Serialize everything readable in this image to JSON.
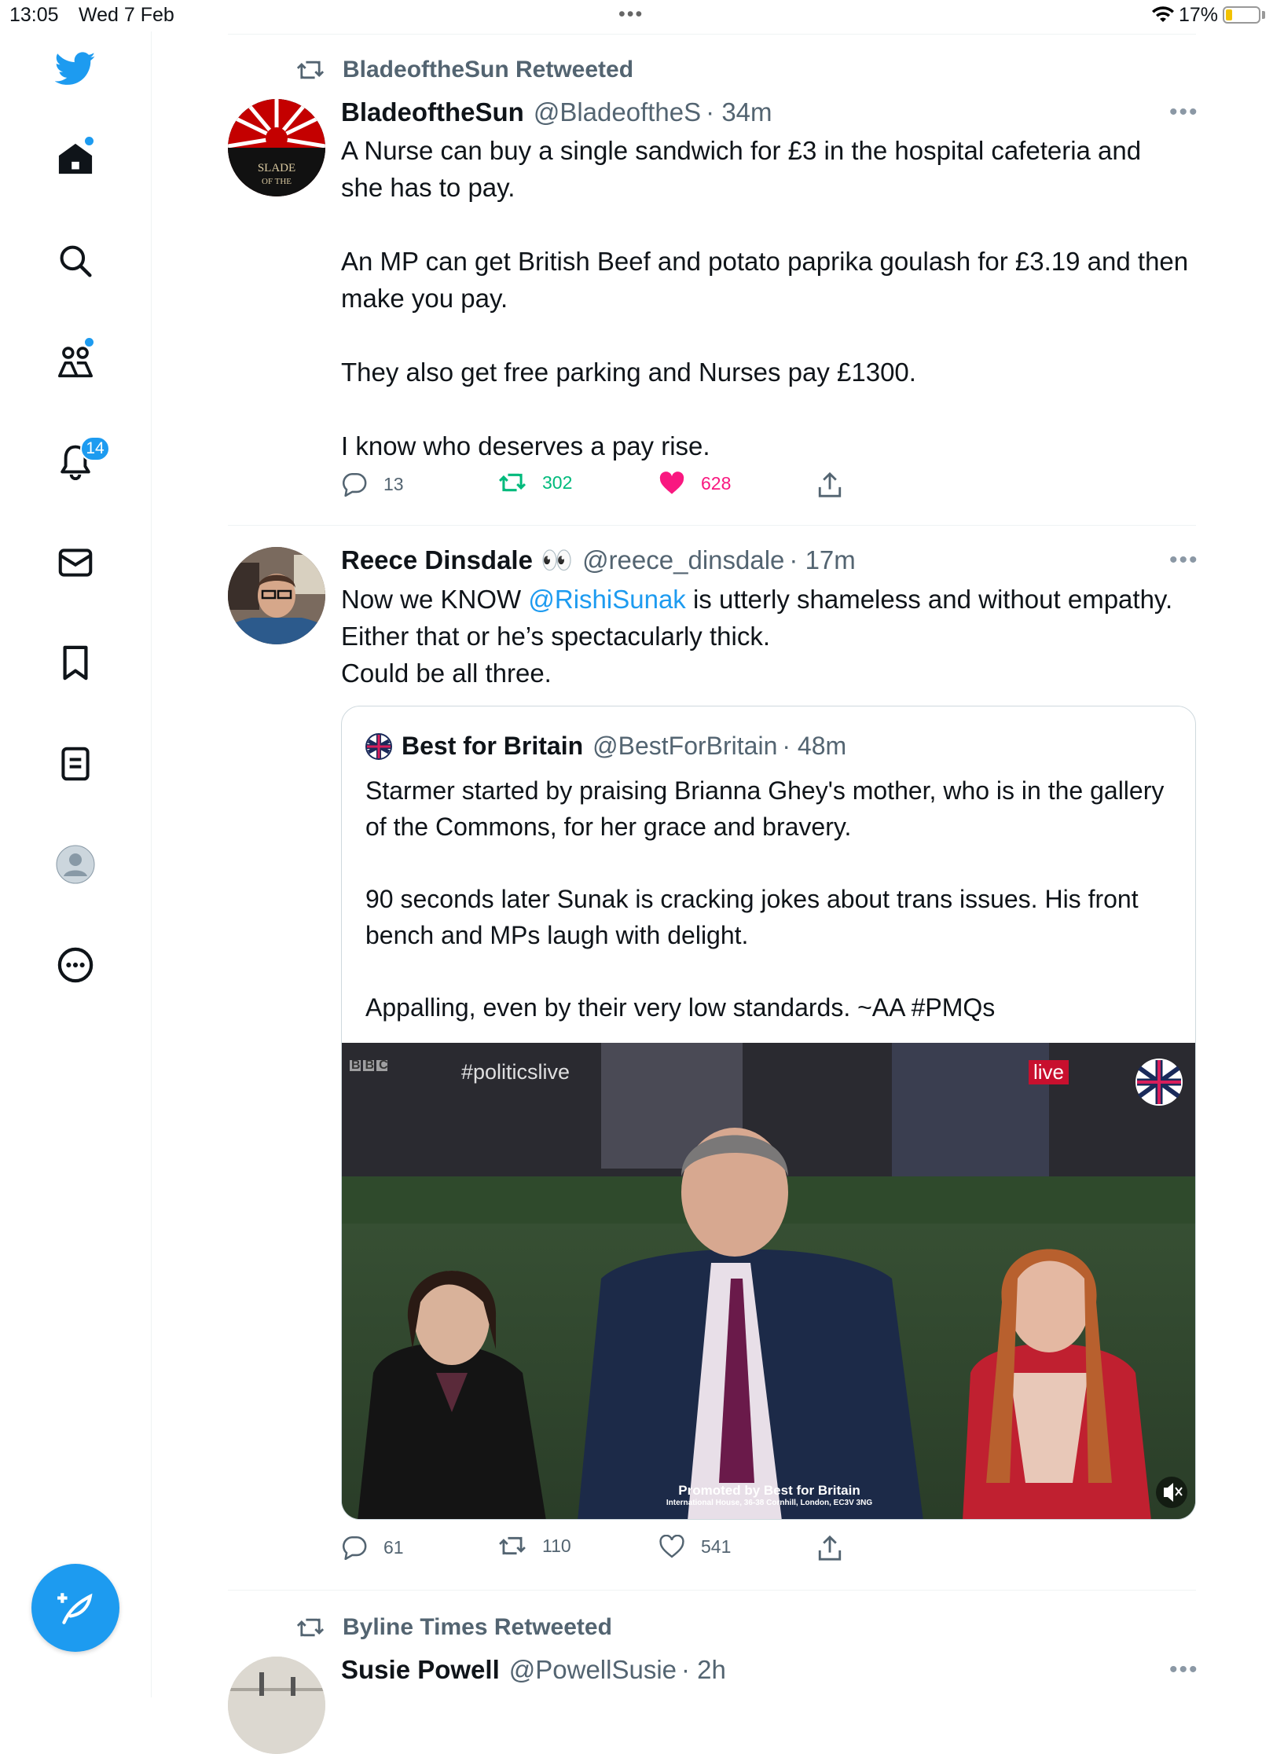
{
  "status_bar": {
    "time": "13:05",
    "date": "Wed 7 Feb",
    "battery": "17%"
  },
  "sidebar": {
    "notifications_badge": "14",
    "items": [
      "twitter-logo",
      "home-icon",
      "search-icon",
      "communities-icon",
      "notifications-icon",
      "messages-icon",
      "bookmarks-icon",
      "lists-icon",
      "profile-icon",
      "more-icon"
    ]
  },
  "tweets": [
    {
      "retweeted_by": "BladeoftheSun Retweeted",
      "name": "BladeoftheSun",
      "handle": "@BladeoftheS",
      "time": "· 34m",
      "text": "A Nurse can buy a single sandwich for £3 in the hospital cafeteria and she has to pay.\n\nAn MP can get British Beef and potato paprika goulash for £3.19 and then make you pay.\n\nThey also get free parking and Nurses pay £1300.\n\nI know who deserves a pay rise.",
      "avatar_text": "Blade of the",
      "replies": "13",
      "retweets": "302",
      "likes": "628"
    },
    {
      "name": "Reece Dinsdale",
      "name_emoji": "👀",
      "handle": "@reece_dinsdale",
      "time": "· 17m",
      "text_before": "Now we KNOW ",
      "mention": "@RishiSunak",
      "text_after": " is utterly shameless and without empathy.\nEither that or he’s spectacularly thick.\nCould be all three.",
      "quote": {
        "name": "Best for Britain",
        "handle": "@BestForBritain",
        "time": "· 48m",
        "text": "Starmer started by praising Brianna Ghey's mother, who is in the gallery of the Commons, for her grace and bravery.\n\n90 seconds later Sunak is cracking jokes about trans issues. His front bench and MPs laugh with delight.\n\nAppalling, even by their very low standards. ~AA #PMQs",
        "video": {
          "channel": "BBC",
          "hashtag": "#politicslive",
          "live": "live",
          "promo": "Promoted by Best for Britain",
          "address": "International House, 36-38 Cornhill, London, EC3V 3NG"
        }
      },
      "replies": "61",
      "retweets": "110",
      "likes": "541"
    },
    {
      "retweeted_by": "Byline Times Retweeted",
      "name": "Susie Powell",
      "handle": "@PowellSusie",
      "time": "· 2h"
    }
  ],
  "colors": {
    "accent": "#1d9bf0",
    "like": "#f91880",
    "retweet": "#00ba7c",
    "muted": "#536471"
  }
}
